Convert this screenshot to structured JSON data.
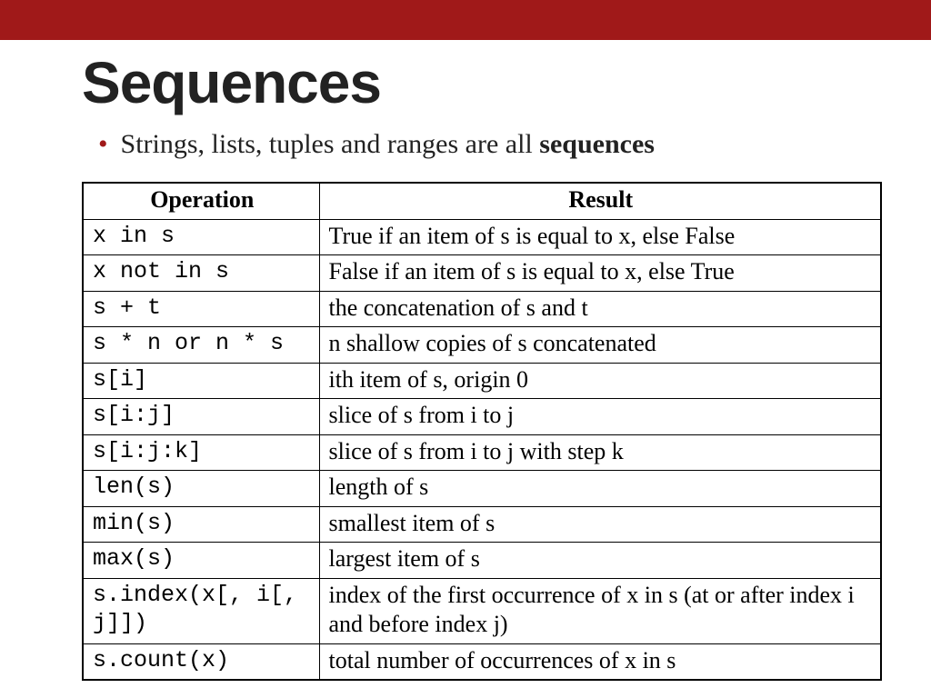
{
  "accent": "#a01919",
  "title": "Sequences",
  "bullet_prefix": "Strings, lists, tuples and ranges are all ",
  "bullet_bold": "sequences",
  "headers": {
    "op": "Operation",
    "res": "Result"
  },
  "rows": [
    {
      "op": "x in s",
      "res": "True if an item of s is equal to x, else False"
    },
    {
      "op": "x not in s",
      "res": "False if an item of s is equal to x, else True"
    },
    {
      "op": "s + t",
      "res": "the concatenation of s and t"
    },
    {
      "op": "s * n or n * s",
      "res": "n shallow copies of s concatenated"
    },
    {
      "op": "s[i]",
      "res": "ith item of s, origin 0"
    },
    {
      "op": "s[i:j]",
      "res": "slice of s from i to j"
    },
    {
      "op": "s[i:j:k]",
      "res": "slice of s from i to j with step k"
    },
    {
      "op": "len(s)",
      "res": "length of s"
    },
    {
      "op": "min(s)",
      "res": "smallest item of s"
    },
    {
      "op": "max(s)",
      "res": "largest item of s"
    },
    {
      "op": "s.index(x[, i[, j]])",
      "res": "index of the first occurrence of x in s (at or after index i and before index j)"
    },
    {
      "op": "s.count(x)",
      "res": "total number of occurrences of x in s"
    }
  ]
}
